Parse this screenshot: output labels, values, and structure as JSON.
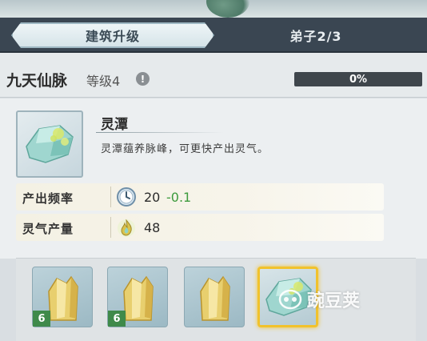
{
  "tabs": [
    {
      "label": "建筑升级",
      "active": true
    },
    {
      "label": "弟子2/3",
      "active": false
    }
  ],
  "header": {
    "title": "九天仙脉",
    "level": "等级4",
    "info_icon": "!",
    "progress_text": "0%",
    "progress_value": 0
  },
  "building": {
    "name": "灵潭",
    "description": "灵潭蕴养脉峰，可更快产出灵气。",
    "icon": "spirit-pool-crystal-icon"
  },
  "stats": [
    {
      "label": "产出频率",
      "icon": "clock-icon",
      "value": "20",
      "delta": "-0.1"
    },
    {
      "label": "灵气产量",
      "icon": "spirit-flame-icon",
      "value": "48",
      "delta": ""
    }
  ],
  "materials": [
    {
      "icon": "gold-ore-icon",
      "count": "6"
    },
    {
      "icon": "gold-ore-icon",
      "count": "6"
    },
    {
      "icon": "gold-ore-icon",
      "count": ""
    },
    {
      "icon": "spirit-pool-crystal-icon",
      "count": "",
      "selected": true
    }
  ],
  "watermark": "豌豆荚",
  "colors": {
    "tab_bar": "#3a4652",
    "progress_fill": "#6bb0c8",
    "delta_green": "#3c9a3c",
    "count_badge": "#3f8a4a",
    "selected_border": "#f1c22c"
  }
}
